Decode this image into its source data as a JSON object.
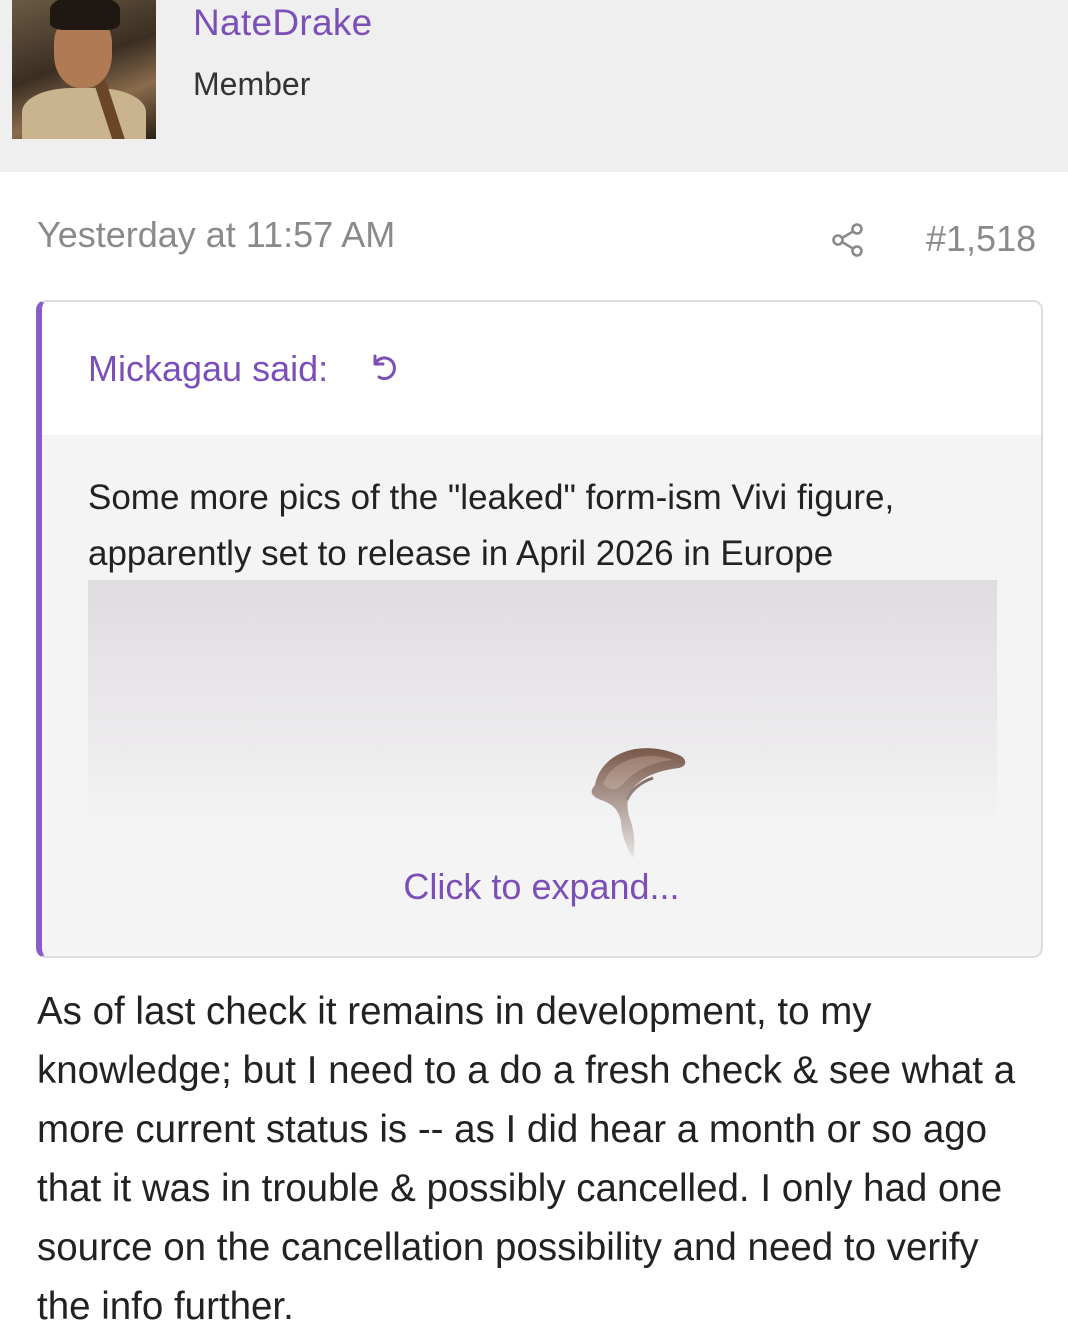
{
  "user": {
    "name": "NateDrake",
    "title": "Member"
  },
  "post": {
    "date": "Yesterday at 11:57 AM",
    "number": "#1,518",
    "body": "As of last check it remains in development, to my knowledge; but I need to a do a fresh check & see what a more current status is -- as I did hear a month or so ago that it was in trouble & possibly cancelled. I only had one source on the cancellation possibility and need to verify the info further."
  },
  "quote": {
    "author_label": "Mickagau said:",
    "text": "Some more pics of the \"leaked\" form-ism Vivi figure, apparently set to release in April 2026 in Europe",
    "expand_label": "Click to expand..."
  },
  "icons": {
    "share": "share-icon",
    "jump": "jump-to-quote-icon"
  },
  "colors": {
    "accent": "#7b4fb8",
    "quote_border": "#8a5ec9",
    "meta_text": "#8a8a8a",
    "header_bg": "#efefef"
  }
}
